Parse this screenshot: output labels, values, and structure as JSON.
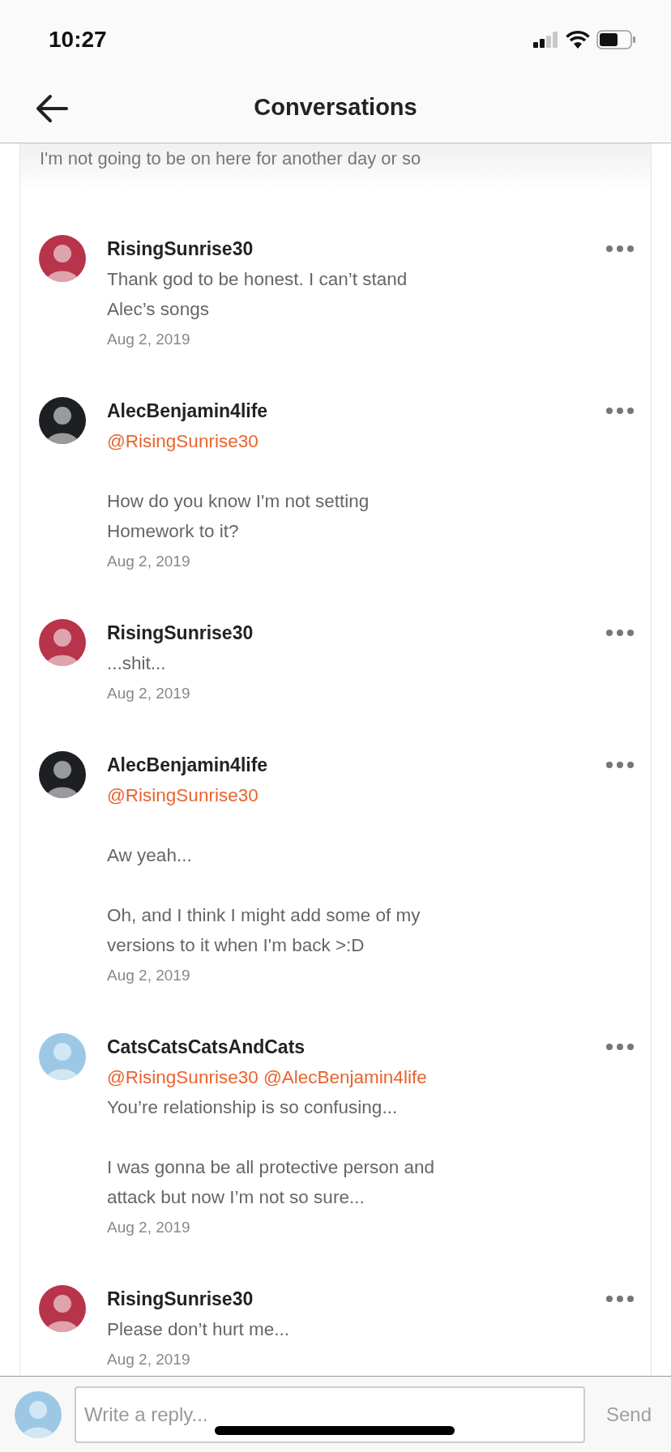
{
  "status_bar": {
    "time": "10:27"
  },
  "header": {
    "title": "Conversations"
  },
  "previous_text": "I'm not going to be on here for another day or so",
  "comments": [
    {
      "author": "RisingSunrise30",
      "avatar": {
        "color": "#b8344a"
      },
      "lines": [
        {
          "kind": "text",
          "text": "Thank god to be honest. I can’t stand"
        },
        {
          "kind": "text",
          "text": "Alec’s songs"
        }
      ],
      "date": "Aug 2, 2019"
    },
    {
      "author": "AlecBenjamin4life",
      "avatar": {
        "color": "#1d1f22"
      },
      "lines": [
        {
          "kind": "mention",
          "mentions": [
            "@RisingSunrise30"
          ]
        },
        {
          "kind": "break"
        },
        {
          "kind": "text",
          "text": "How do you know I'm not setting"
        },
        {
          "kind": "text",
          "text": "Homework to it?"
        }
      ],
      "date": "Aug 2, 2019"
    },
    {
      "author": "RisingSunrise30",
      "avatar": {
        "color": "#b8344a"
      },
      "lines": [
        {
          "kind": "text",
          "text": "...shit..."
        }
      ],
      "date": "Aug 2, 2019"
    },
    {
      "author": "AlecBenjamin4life",
      "avatar": {
        "color": "#1d1f22"
      },
      "lines": [
        {
          "kind": "mention",
          "mentions": [
            "@RisingSunrise30"
          ]
        },
        {
          "kind": "break"
        },
        {
          "kind": "text",
          "text": "Aw yeah..."
        },
        {
          "kind": "break"
        },
        {
          "kind": "text",
          "text": "Oh, and I think I might add some of my"
        },
        {
          "kind": "text",
          "text": "versions to it when I'm back >:D"
        }
      ],
      "date": "Aug 2, 2019"
    },
    {
      "author": "CatsCatsCatsAndCats",
      "avatar": {
        "color": "#9cc8e6"
      },
      "lines": [
        {
          "kind": "mention",
          "mentions": [
            "@RisingSunrise30",
            "@AlecBenjamin4life"
          ]
        },
        {
          "kind": "text",
          "text": "You’re relationship is so confusing..."
        },
        {
          "kind": "break"
        },
        {
          "kind": "text",
          "text": "I was gonna be all protective person and"
        },
        {
          "kind": "text",
          "text": "attack but now I’m not so sure..."
        }
      ],
      "date": "Aug 2, 2019"
    },
    {
      "author": "RisingSunrise30",
      "avatar": {
        "color": "#b8344a"
      },
      "lines": [
        {
          "kind": "text",
          "text": "Please don’t hurt me..."
        }
      ],
      "date": "Aug 2, 2019"
    }
  ],
  "composer": {
    "avatar": {
      "color": "#9cc8e6"
    },
    "placeholder": "Write a reply...",
    "send": {
      "label": "Send",
      "disabled": true
    }
  }
}
